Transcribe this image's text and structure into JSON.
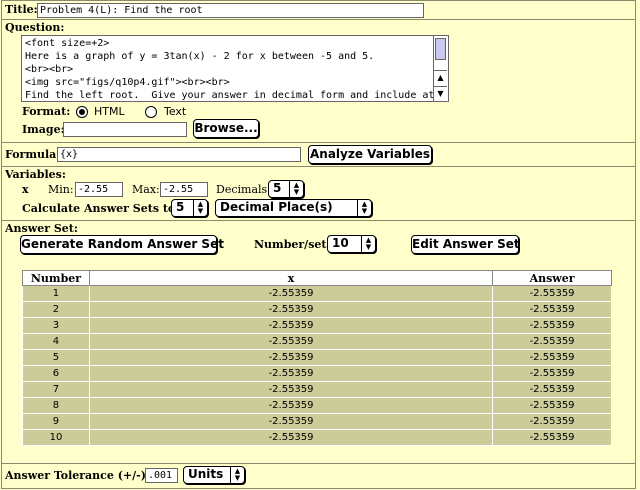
{
  "title": {
    "label": "Title:",
    "value": "Problem 4(L):  Find the root"
  },
  "question": {
    "label": "Question:",
    "lines": [
      "<font size=+2>",
      "Here is a graph of y = 3tan(x) - 2 for x between -5 and 5.",
      "<br><br>",
      "<img src=\"figs/q10p4.gif\"><br><br>",
      "Find the left root.  Give your answer in decimal form and include at"
    ]
  },
  "format": {
    "label": "Format:",
    "options": [
      "HTML",
      "Text"
    ],
    "selected": "HTML"
  },
  "image": {
    "label": "Image:",
    "value": "",
    "browse_label": "Browse..."
  },
  "formula": {
    "label": "Formula:",
    "value": "{x}",
    "analyze_label": "Analyze Variables"
  },
  "variables": {
    "label": "Variables:",
    "var_name": "x",
    "min_label": "Min:",
    "min_value": "-2.55",
    "max_label": "Max:",
    "max_value": "-2.55",
    "decimals_label": "Decimals:",
    "decimals_value": "5"
  },
  "calculate": {
    "label": "Calculate Answer Sets to:",
    "value": "5",
    "unit": "Decimal Place(s)"
  },
  "answer_set": {
    "label": "Answer Set:",
    "generate_label": "Generate Random Answer Set",
    "number_per_set_label": "Number/set:",
    "number_per_set_value": "10",
    "edit_label": "Edit Answer Set",
    "columns": [
      "Number",
      "x",
      "Answer"
    ],
    "rows": [
      [
        "1",
        "-2.55359",
        "-2.55359"
      ],
      [
        "2",
        "-2.55359",
        "-2.55359"
      ],
      [
        "3",
        "-2.55359",
        "-2.55359"
      ],
      [
        "4",
        "-2.55359",
        "-2.55359"
      ],
      [
        "5",
        "-2.55359",
        "-2.55359"
      ],
      [
        "6",
        "-2.55359",
        "-2.55359"
      ],
      [
        "7",
        "-2.55359",
        "-2.55359"
      ],
      [
        "8",
        "-2.55359",
        "-2.55359"
      ],
      [
        "9",
        "-2.55359",
        "-2.55359"
      ],
      [
        "10",
        "-2.55359",
        "-2.55359"
      ]
    ]
  },
  "tolerance": {
    "label": "Answer Tolerance (+/-):",
    "value": ".001",
    "units_label": "Units"
  },
  "icons": {
    "select_arrow": "up-down-arrows-icon",
    "scroll_up": "arrow-up-icon",
    "scroll_down": "arrow-down-icon"
  },
  "colors": {
    "background": "#ffffcc",
    "table_cell": "#cccc99",
    "scroll_thumb": "#c8c8f0"
  }
}
